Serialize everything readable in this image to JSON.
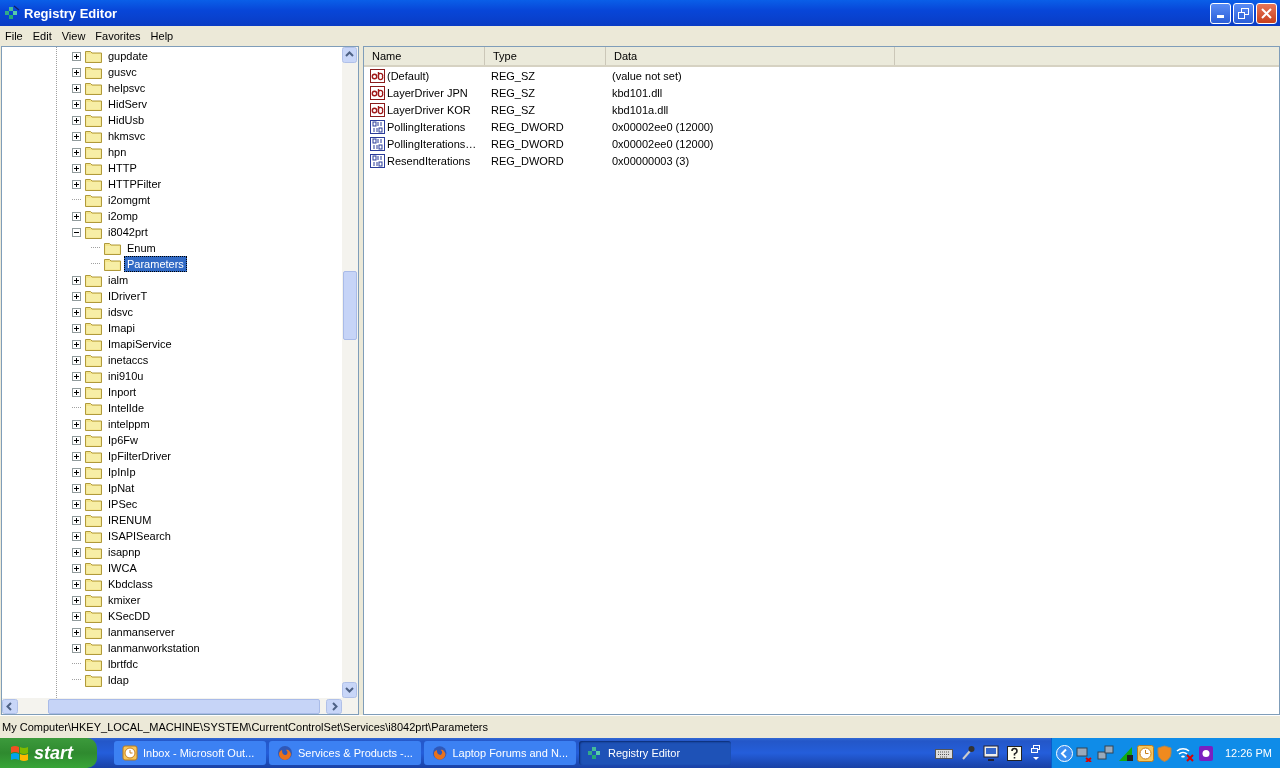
{
  "window": {
    "title": "Registry Editor"
  },
  "menu": [
    "File",
    "Edit",
    "View",
    "Favorites",
    "Help"
  ],
  "tree": [
    {
      "label": "gupdate",
      "expandable": true,
      "expanded": false,
      "selected": false
    },
    {
      "label": "gusvc",
      "expandable": true,
      "expanded": false,
      "selected": false
    },
    {
      "label": "helpsvc",
      "expandable": true,
      "expanded": false,
      "selected": false
    },
    {
      "label": "HidServ",
      "expandable": true,
      "expanded": false,
      "selected": false
    },
    {
      "label": "HidUsb",
      "expandable": true,
      "expanded": false,
      "selected": false
    },
    {
      "label": "hkmsvc",
      "expandable": true,
      "expanded": false,
      "selected": false
    },
    {
      "label": "hpn",
      "expandable": true,
      "expanded": false,
      "selected": false
    },
    {
      "label": "HTTP",
      "expandable": true,
      "expanded": false,
      "selected": false
    },
    {
      "label": "HTTPFilter",
      "expandable": true,
      "expanded": false,
      "selected": false
    },
    {
      "label": "i2omgmt",
      "expandable": false,
      "expanded": false,
      "selected": false
    },
    {
      "label": "i2omp",
      "expandable": true,
      "expanded": false,
      "selected": false
    },
    {
      "label": "i8042prt",
      "expandable": true,
      "expanded": true,
      "selected": false,
      "children": [
        {
          "label": "Enum",
          "expandable": false,
          "expanded": false,
          "selected": false
        },
        {
          "label": "Parameters",
          "expandable": false,
          "expanded": false,
          "selected": true
        }
      ]
    },
    {
      "label": "ialm",
      "expandable": true,
      "expanded": false,
      "selected": false
    },
    {
      "label": "IDriverT",
      "expandable": true,
      "expanded": false,
      "selected": false
    },
    {
      "label": "idsvc",
      "expandable": true,
      "expanded": false,
      "selected": false
    },
    {
      "label": "Imapi",
      "expandable": true,
      "expanded": false,
      "selected": false
    },
    {
      "label": "ImapiService",
      "expandable": true,
      "expanded": false,
      "selected": false
    },
    {
      "label": "inetaccs",
      "expandable": true,
      "expanded": false,
      "selected": false
    },
    {
      "label": "ini910u",
      "expandable": true,
      "expanded": false,
      "selected": false
    },
    {
      "label": "Inport",
      "expandable": true,
      "expanded": false,
      "selected": false
    },
    {
      "label": "IntelIde",
      "expandable": false,
      "expanded": false,
      "selected": false
    },
    {
      "label": "intelppm",
      "expandable": true,
      "expanded": false,
      "selected": false
    },
    {
      "label": "Ip6Fw",
      "expandable": true,
      "expanded": false,
      "selected": false
    },
    {
      "label": "IpFilterDriver",
      "expandable": true,
      "expanded": false,
      "selected": false
    },
    {
      "label": "IpInIp",
      "expandable": true,
      "expanded": false,
      "selected": false
    },
    {
      "label": "IpNat",
      "expandable": true,
      "expanded": false,
      "selected": false
    },
    {
      "label": "IPSec",
      "expandable": true,
      "expanded": false,
      "selected": false
    },
    {
      "label": "IRENUM",
      "expandable": true,
      "expanded": false,
      "selected": false
    },
    {
      "label": "ISAPISearch",
      "expandable": true,
      "expanded": false,
      "selected": false
    },
    {
      "label": "isapnp",
      "expandable": true,
      "expanded": false,
      "selected": false
    },
    {
      "label": "IWCA",
      "expandable": true,
      "expanded": false,
      "selected": false
    },
    {
      "label": "Kbdclass",
      "expandable": true,
      "expanded": false,
      "selected": false
    },
    {
      "label": "kmixer",
      "expandable": true,
      "expanded": false,
      "selected": false
    },
    {
      "label": "KSecDD",
      "expandable": true,
      "expanded": false,
      "selected": false
    },
    {
      "label": "lanmanserver",
      "expandable": true,
      "expanded": false,
      "selected": false
    },
    {
      "label": "lanmanworkstation",
      "expandable": true,
      "expanded": false,
      "selected": false
    },
    {
      "label": "lbrtfdc",
      "expandable": false,
      "expanded": false,
      "selected": false
    },
    {
      "label": "ldap",
      "expandable": false,
      "expanded": false,
      "selected": false
    }
  ],
  "values": {
    "columns": [
      "Name",
      "Type",
      "Data"
    ],
    "rows": [
      {
        "kind": "string",
        "name": "(Default)",
        "type": "REG_SZ",
        "data": "(value not set)"
      },
      {
        "kind": "string",
        "name": "LayerDriver JPN",
        "type": "REG_SZ",
        "data": "kbd101.dll"
      },
      {
        "kind": "string",
        "name": "LayerDriver KOR",
        "type": "REG_SZ",
        "data": "kbd101a.dll"
      },
      {
        "kind": "dword",
        "name": "PollingIterations",
        "type": "REG_DWORD",
        "data": "0x00002ee0 (12000)"
      },
      {
        "kind": "dword",
        "name": "PollingIterations…",
        "type": "REG_DWORD",
        "data": "0x00002ee0 (12000)"
      },
      {
        "kind": "dword",
        "name": "ResendIterations",
        "type": "REG_DWORD",
        "data": "0x00000003 (3)"
      }
    ]
  },
  "status_bar": "My Computer\\HKEY_LOCAL_MACHINE\\SYSTEM\\CurrentControlSet\\Services\\i8042prt\\Parameters",
  "taskbar": {
    "start": "start",
    "tasks": [
      {
        "kind": "mail",
        "label": "Inbox - Microsoft Out...",
        "selected": false
      },
      {
        "kind": "browser",
        "label": "Services & Products -...",
        "selected": false
      },
      {
        "kind": "browser",
        "label": "Laptop Forums and N...",
        "selected": false
      },
      {
        "kind": "registry",
        "label": "Registry Editor",
        "selected": true
      }
    ],
    "clock": "12:26 PM"
  }
}
